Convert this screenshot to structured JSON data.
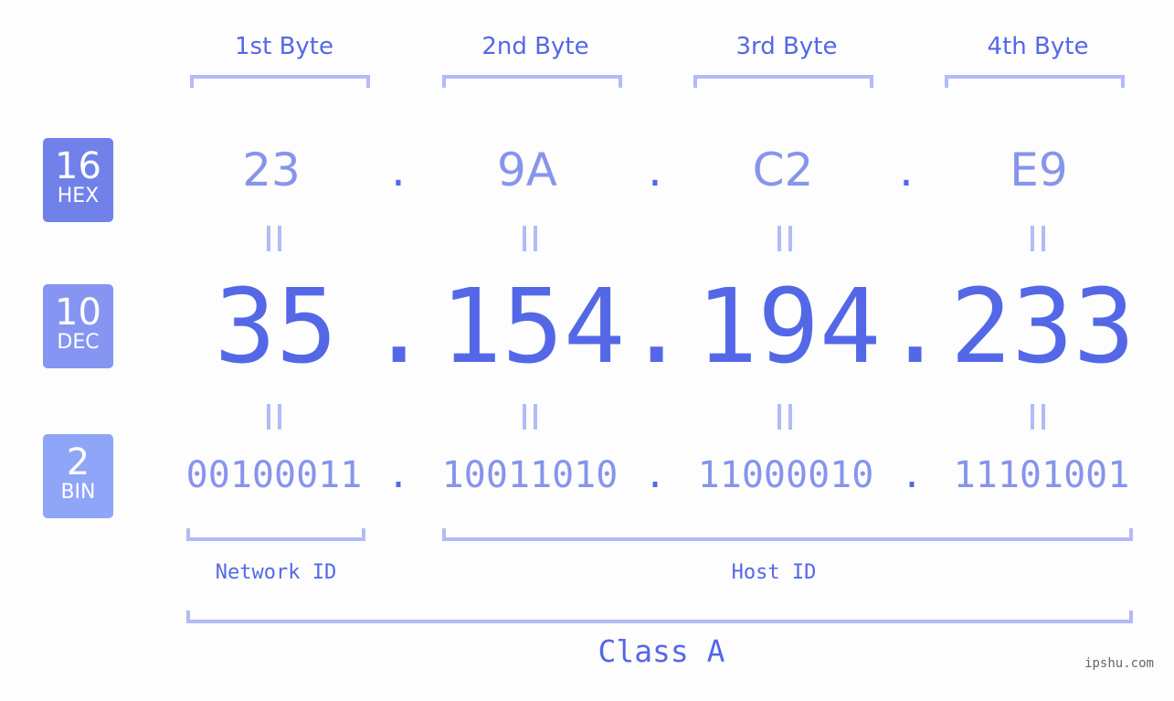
{
  "bases": [
    {
      "number": "16",
      "label": "HEX",
      "color": "#7181ea"
    },
    {
      "number": "10",
      "label": "DEC",
      "color": "#8595f1"
    },
    {
      "number": "2",
      "label": "BIN",
      "color": "#8ea5f8"
    }
  ],
  "bytes": [
    {
      "header": "1st Byte",
      "hex": "23",
      "dec": "35",
      "bin": "00100011"
    },
    {
      "header": "2nd Byte",
      "hex": "9A",
      "dec": "154",
      "bin": "10011010"
    },
    {
      "header": "3rd Byte",
      "hex": "C2",
      "dec": "194",
      "bin": "11000010"
    },
    {
      "header": "4th Byte",
      "hex": "E9",
      "dec": "233",
      "bin": "11101001"
    }
  ],
  "separator": ".",
  "ip_address": "35.154.194.233",
  "parts": {
    "network": "Network ID",
    "host": "Host ID"
  },
  "ip_class": "Class A",
  "watermark": "ipshu.com",
  "colors": {
    "primary": "#5468e7",
    "secondary": "#8794ed",
    "bracket": "#b2bbf7",
    "background": "#fcfdfc"
  }
}
